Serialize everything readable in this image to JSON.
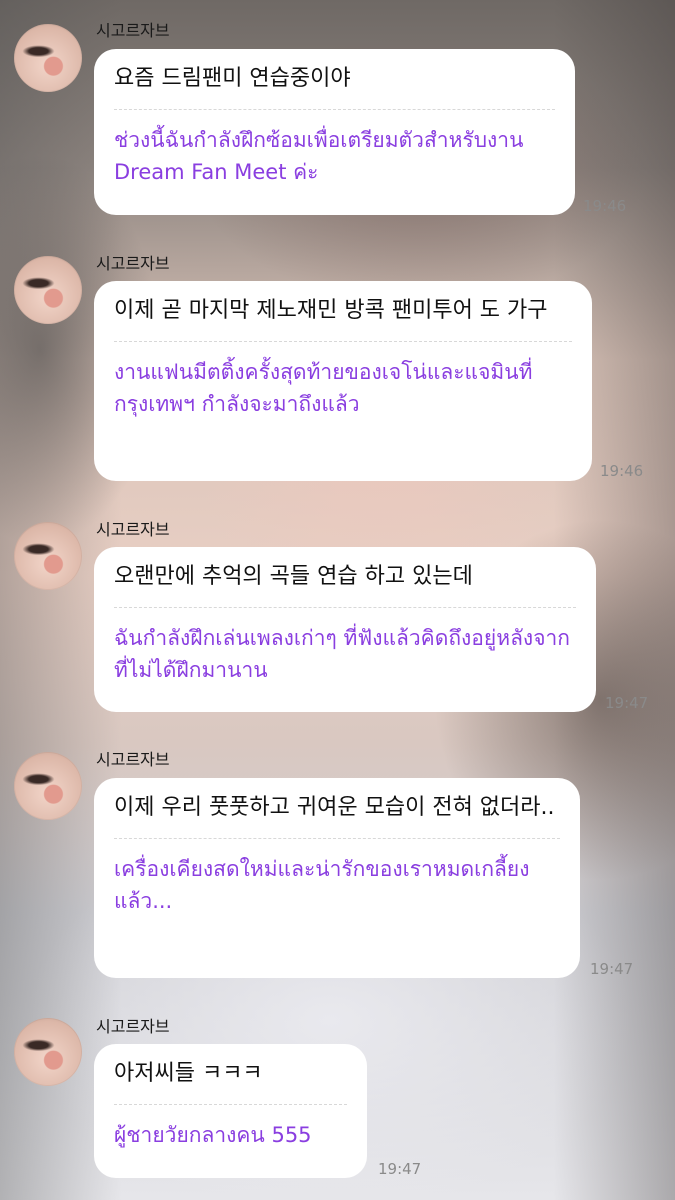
{
  "chat": {
    "accent_color": "#8a3ee0",
    "messages": [
      {
        "sender": "시고르자브",
        "korean": "요즘 드림팬미 연습중이야",
        "thai": "ช่วงนี้ฉันกำลังฝึกซ้อมเพื่อเตรียมตัวสำหรับงาน Dream Fan Meet ค่ะ",
        "time": "19:46"
      },
      {
        "sender": "시고르자브",
        "korean": "이제 곧 마지막 제노재민 방콕 팬미투어 도 가구",
        "thai": "งานแฟนมีตติ้งครั้งสุดท้ายของเจโน่และแจมินที่กรุงเทพฯ กำลังจะมาถึงแล้ว",
        "time": "19:46"
      },
      {
        "sender": "시고르자브",
        "korean": "오랜만에 추억의 곡들 연습 하고 있는데",
        "thai": "ฉันกำลังฝึกเล่นเพลงเก่าๆ ที่ฟังแล้วคิดถึงอยู่หลังจากที่ไม่ได้ฝึกมานาน",
        "time": "19:47"
      },
      {
        "sender": "시고르자브",
        "korean": "이제 우리 풋풋하고 귀여운 모습이 전혀 없더라..",
        "thai": "เครื่องเคียงสดใหม่และน่ารักของเราหมดเกลี้ยงแล้ว...",
        "time": "19:47"
      },
      {
        "sender": "시고르자브",
        "korean": "아저씨들 ㅋㅋㅋ",
        "thai": "ผู้ชายวัยกลางคน 555",
        "time": "19:47"
      }
    ]
  }
}
